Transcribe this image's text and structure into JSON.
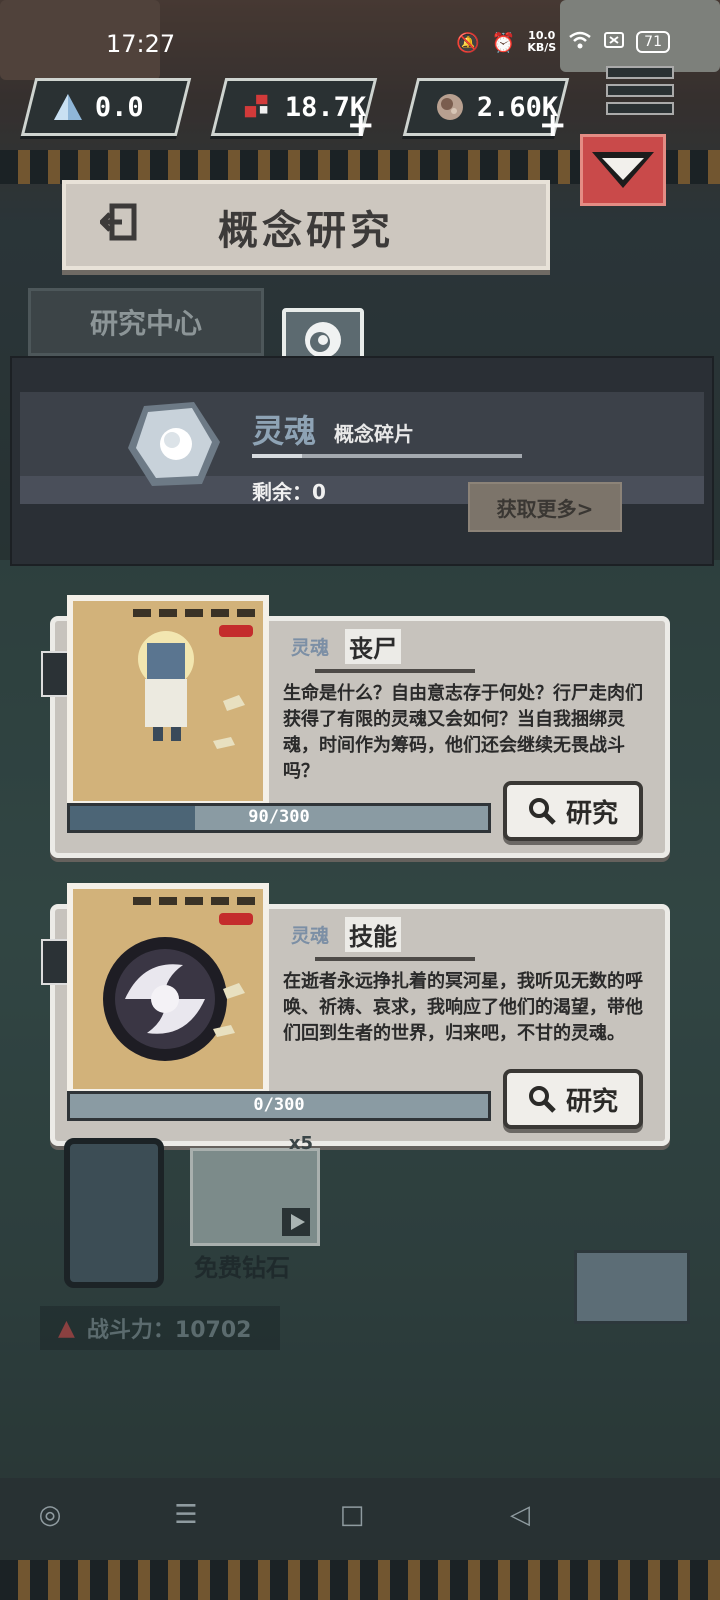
{
  "status_bar": {
    "time": "17:27",
    "net_speed_value": "10.0",
    "net_speed_unit": "KB/S",
    "battery": "71"
  },
  "resources": [
    {
      "icon": "pyramid-icon",
      "value": "0.0",
      "has_plus": false
    },
    {
      "icon": "gem-cluster-icon",
      "value": "18.7K",
      "has_plus": true
    },
    {
      "icon": "ore-icon",
      "value": "2.60K",
      "has_plus": true
    }
  ],
  "header": {
    "title": "概念研究",
    "tab_label": "研究中心"
  },
  "item": {
    "name": "灵魂",
    "subtitle": "概念碎片",
    "remaining": "剩余：0",
    "get_more_label": "获取更多>"
  },
  "cards": [
    {
      "type": "灵魂",
      "name": "丧尸",
      "description": "生命是什么？自由意志存于何处？行尸走肉们获得了有限的灵魂又会如何？当自我捆绑灵魂，时间作为筹码，他们还会继续无畏战斗吗？",
      "progress_text": "90/300",
      "progress": 0.3,
      "button_label": "研究"
    },
    {
      "type": "灵魂",
      "name": "技能",
      "description": "在逝者永远挣扎着的冥河星，我听见无数的呼唤、祈祷、哀求，我响应了他们的渴望，带他们回到生者的世界，归来吧，不甘的灵魂。",
      "progress_text": "0/300",
      "progress": 0.0,
      "button_label": "研究"
    }
  ],
  "background_ui": {
    "free_diamond_label": "免费钻石",
    "video_badge": "x5",
    "power_label": "战斗力：10702"
  },
  "colors": {
    "accent_red": "#c94a4a",
    "panel_dark": "#2a2f35",
    "card_bg": "#c7c3bd",
    "progress_fill": "#4c6576"
  }
}
